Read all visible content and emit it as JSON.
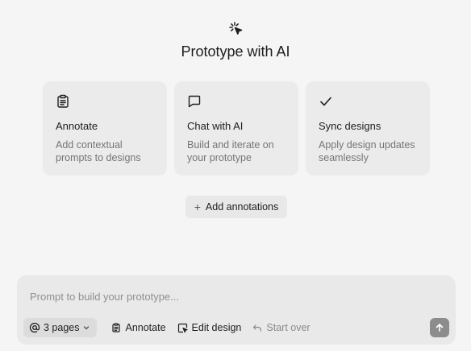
{
  "hero": {
    "title": "Prototype with AI",
    "icon": "sparkle-cursor-icon"
  },
  "cards": [
    {
      "icon": "clipboard-icon",
      "title": "Annotate",
      "description": "Add contextual prompts to designs"
    },
    {
      "icon": "chat-bubble-icon",
      "title": "Chat with AI",
      "description": "Build and iterate on your prototype"
    },
    {
      "icon": "checkmark-icon",
      "title": "Sync designs",
      "description": "Apply design updates seamlessly"
    }
  ],
  "add_annotations": {
    "label": "Add annotations",
    "icon": "plus-icon"
  },
  "composer": {
    "placeholder": "Prompt to build your prototype...",
    "pages_label": "3 pages",
    "annotate_label": "Annotate",
    "edit_design_label": "Edit design",
    "start_over_label": "Start over",
    "send_icon": "arrow-up-icon"
  },
  "colors": {
    "background": "#f5f5f5",
    "card": "#ebebeb",
    "text": "#1e1e1e",
    "muted_text": "#757575",
    "send_button": "#8c8c8c"
  }
}
